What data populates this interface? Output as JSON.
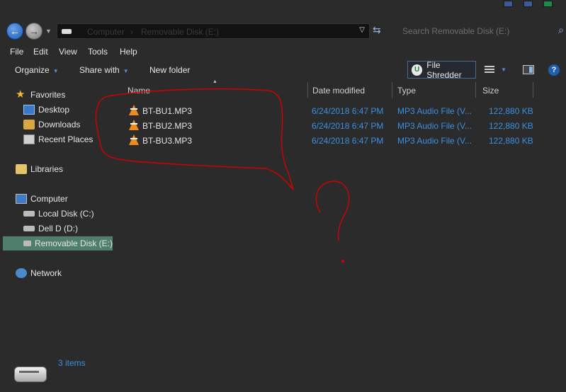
{
  "window": {
    "colors": {
      "background": "#2b2b2b",
      "link_blue": "#3b8fe0",
      "selected": "#4f7f6a",
      "annotation": "#d40000"
    }
  },
  "address": {
    "crumbs": [
      "Computer",
      "Removable Disk (E:)"
    ],
    "crumb_sep": "›"
  },
  "search": {
    "placeholder": "Search Removable Disk (E:)"
  },
  "menu": [
    "File",
    "Edit",
    "View",
    "Tools",
    "Help"
  ],
  "toolbar": {
    "organize": "Organize",
    "share_with": "Share with",
    "new_folder": "New folder",
    "file_shredder": "File Shredder"
  },
  "nav": {
    "favorites": "Favorites",
    "desktop": "Desktop",
    "downloads": "Downloads",
    "recent_places": "Recent Places",
    "libraries": "Libraries",
    "computer": "Computer",
    "local_disk": "Local Disk (C:)",
    "dell_d": "Dell D (D:)",
    "removable_disk": "Removable Disk (E:)",
    "network": "Network"
  },
  "columns": {
    "name": "Name",
    "date_modified": "Date modified",
    "type": "Type",
    "size": "Size"
  },
  "files": [
    {
      "name": "BT-BU1.MP3",
      "date": "6/24/2018 6:47 PM",
      "type": "MP3 Audio File (V...",
      "size": "122,880 KB",
      "icon": "vlc-cone-icon"
    },
    {
      "name": "BT-BU2.MP3",
      "date": "6/24/2018 6:47 PM",
      "type": "MP3 Audio File (V...",
      "size": "122,880 KB",
      "icon": "vlc-cone-icon"
    },
    {
      "name": "BT-BU3.MP3",
      "date": "6/24/2018 6:47 PM",
      "type": "MP3 Audio File (V...",
      "size": "122,880 KB",
      "icon": "vlc-cone-icon"
    }
  ],
  "status": {
    "items": "3 items"
  }
}
